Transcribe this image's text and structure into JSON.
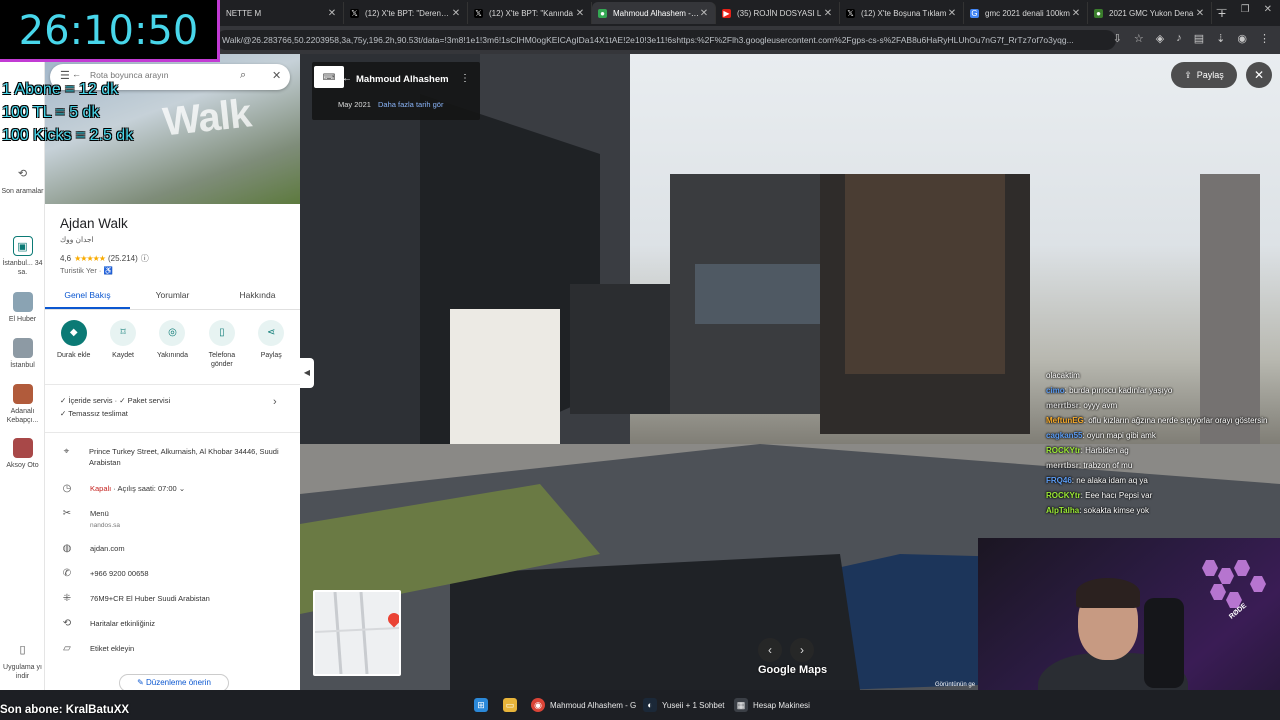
{
  "timer": "26:10:50",
  "sub_rates": [
    "1 Abone = 12 dk",
    "100 TL = 5 dk",
    "100 Kicks = 2.5 dk"
  ],
  "browser": {
    "tabs": [
      {
        "title": "NETTE M",
        "icon": "generic-tab-icon"
      },
      {
        "title": "(12) X'te BPT: \"Deren Ta",
        "icon": "x-logo-icon"
      },
      {
        "title": "(12) X'te BPT: \"Kanında",
        "icon": "x-logo-icon"
      },
      {
        "title": "Mahmoud Alhashem - G",
        "icon": "maps-pin-icon"
      },
      {
        "title": "(35) ROJİN DOSYASI L",
        "icon": "youtube-icon"
      },
      {
        "title": "(12) X'te Boşuna Tıklam",
        "icon": "x-logo-icon"
      },
      {
        "title": "gmc 2021 denali 100km",
        "icon": "google-icon"
      },
      {
        "title": "2021 GMC Yukon Dena",
        "icon": "generic-tab-icon"
      }
    ],
    "active_tab": 3,
    "url": "Walk/@26.283766,50.2203958,3a,75y,196.2h,90.53t/data=!3m8!1e1!3m6!1sCIHM0ogKEICAgIDa14X1tAE!2e10!3e11!6shttps:%2F%2Flh3.googleusercontent.com%2Fgps-cs-s%2FAB8u6HaRyHLUhOu7nG7f_RrTz7of7o3yqg..."
  },
  "streetview": {
    "contributor": "Mahmoud Alhashem",
    "date": "May 2021",
    "older_link": "Daha fazla tarih gör",
    "share_label": "Paylaş",
    "logo": "Google Maps",
    "copyright": "Görüntünün ge"
  },
  "rail": [
    {
      "label": "Son aramalar",
      "icon": "history-icon"
    },
    {
      "label": "İstanbul... 34 sa.",
      "icon": "bus-icon"
    },
    {
      "label": "El Huber",
      "icon": "place-thumb-icon"
    },
    {
      "label": "İstanbul",
      "icon": "place-thumb-icon"
    },
    {
      "label": "Adanalı Kebapçı...",
      "icon": "place-thumb-icon"
    },
    {
      "label": "Aksoy Oto",
      "icon": "place-thumb-icon"
    },
    {
      "label": "Uygulama yı indir",
      "icon": "phone-icon"
    }
  ],
  "place": {
    "search_placeholder": "Rota boyunca arayın",
    "hero_text": "Walk",
    "name": "Ajdan Walk",
    "name_ar": "اجدان ووك",
    "rating": "4,6",
    "reviews": "(25.214)",
    "type": "Turistik Yer · ♿",
    "tabs": [
      "Genel Bakış",
      "Yorumlar",
      "Hakkında"
    ],
    "actions": [
      {
        "label": "Durak ekle",
        "icon": "add-stop-icon"
      },
      {
        "label": "Kaydet",
        "icon": "bookmark-icon"
      },
      {
        "label": "Yakınında",
        "icon": "nearby-icon"
      },
      {
        "label": "Telefona gönder",
        "icon": "send-to-phone-icon"
      },
      {
        "label": "Paylaş",
        "icon": "share-icon"
      }
    ],
    "services": [
      "İçeride servis",
      "Paket servisi",
      "Temassız teslimat"
    ],
    "address": "Prince Turkey Street, Alkurnaish, Al Khobar 34446, Suudi Arabistan",
    "hours_status": "Kapalı",
    "hours_text": " · Açılış saati: 07:00",
    "menu_label": "Menü",
    "menu_sub": "nandos.sa",
    "website": "ajdan.com",
    "phone": "+966 9200 00658",
    "plus_code": "76M9+CR El Huber Suudi Arabistan",
    "maps_activity": "Haritalar etkinliğiniz",
    "add_label": "Etiket ekleyin",
    "edit_name": "Düzenleme önerin"
  },
  "chat": [
    {
      "user": "",
      "msg": "olacaktim",
      "color": "#ffffff"
    },
    {
      "user": "cimo",
      "msg": ": burda pırıocu kadınlar yaşıyo",
      "color": "#5b9cf4"
    },
    {
      "user": "merrtbsr",
      "msg": ": oyyy avm",
      "color": "#cfcfcf"
    },
    {
      "user": "MeftunEG",
      "msg": ": oflu kızların ağzına nerde sıçıyorlar orayı göstersin",
      "color": "#f4a92b"
    },
    {
      "user": "cagkan55",
      "msg": ": oyun mapi gibi amk",
      "color": "#5b9cf4"
    },
    {
      "user": "ROCKYtr",
      "msg": ": Harbiden ag",
      "color": "#9bea34"
    },
    {
      "user": "merrtbsr",
      "msg": ": trabzon of mu",
      "color": "#cfcfcf"
    },
    {
      "user": "FRQ46",
      "msg": ": ne alaka idam aq ya",
      "color": "#5b9cf4"
    },
    {
      "user": "ROCKYtr",
      "msg": ": Eee hacı Pepsi var",
      "color": "#9bea34"
    },
    {
      "user": "AlpTalha",
      "msg": ": sokakta kimse yok",
      "color": "#9bea34"
    }
  ],
  "overlay": {
    "last_sub": "Son abone: KralBatuXX",
    "rode": "RØDE"
  },
  "taskbar": [
    {
      "label": "Mahmoud Alhashem - G",
      "icon": "chrome-icon"
    },
    {
      "label": "Yuseii + 1 Sohbet",
      "icon": "steam-icon"
    },
    {
      "label": "Hesap Makinesi",
      "icon": "calculator-icon"
    }
  ],
  "colors": {
    "accent": "#0b7a75",
    "link": "#0b57d0",
    "timer": "#48d6ea",
    "frame": "#c23bd4"
  }
}
